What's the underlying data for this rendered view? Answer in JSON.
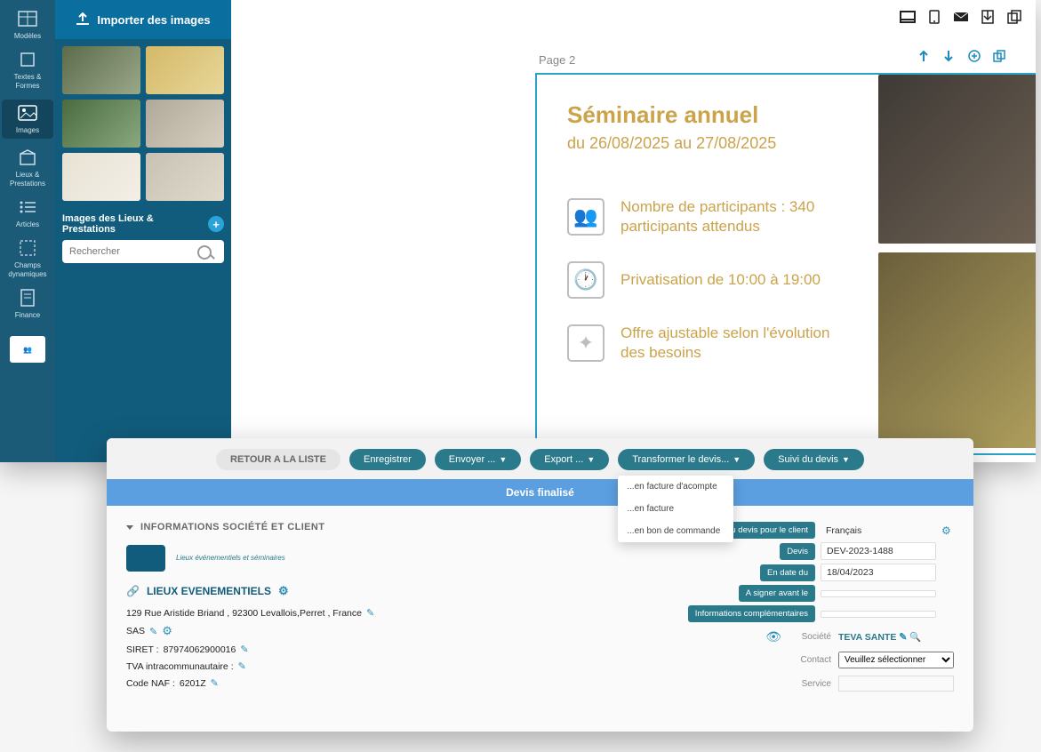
{
  "editor": {
    "rail": {
      "modeles": "Modèles",
      "textes": "Textes & Formes",
      "images": "Images",
      "lieux": "Lieux & Prestations",
      "articles": "Articles",
      "champs": "Champs dynamiques",
      "finance": "Finance"
    },
    "side": {
      "import_btn": "Importer des images",
      "section_title": "Images des Lieux & Prestations",
      "search_placeholder": "Rechercher"
    },
    "canvas": {
      "page_label": "Page 2",
      "doc": {
        "title": "Séminaire annuel",
        "dates": "du 26/08/2025 au 27/08/2025",
        "participants": "Nombre de participants : 340 participants attendus",
        "privatisation": "Privatisation de 10:00 à 19:00",
        "offre": "Offre ajustable selon l'évolution des besoins"
      }
    }
  },
  "devis": {
    "toolbar": {
      "retour": "RETOUR A LA LISTE",
      "enregistrer": "Enregistrer",
      "envoyer": "Envoyer ...",
      "export": "Export ...",
      "transformer": "Transformer le devis...",
      "suivi": "Suivi du devis"
    },
    "dropdown": {
      "acompte": "...en facture d'acompte",
      "facture": "...en facture",
      "commande": "...en bon de commande"
    },
    "banner": "Devis finalisé",
    "section_title": "INFORMATIONS SOCIÉTÉ ET CLIENT",
    "company": {
      "logo_tag": "Lieux événementiels et séminaires",
      "name": "LIEUX EVENEMENTIELS",
      "address": "129 Rue Aristide Briand , 92300 Levallois,Perret , France",
      "forme": "SAS",
      "siret_label": "SIRET :",
      "siret": "87974062900016",
      "tva_label": "TVA intracommunautaire :",
      "naf_label": "Code NAF :",
      "naf": "6201Z"
    },
    "right": {
      "langue_label": "Langue du devis pour le client",
      "langue_val": "Français",
      "devis_label": "Devis",
      "devis_val": "DEV-2023-1488",
      "date_label": "En date du",
      "date_val": "18/04/2023",
      "signer_label": "A signer avant le",
      "info_label": "Informations complémentaires",
      "societe_label": "Société",
      "societe_val": "TEVA SANTE",
      "contact_label": "Contact",
      "contact_sel": "Veuillez sélectionner",
      "service_label": "Service"
    }
  }
}
